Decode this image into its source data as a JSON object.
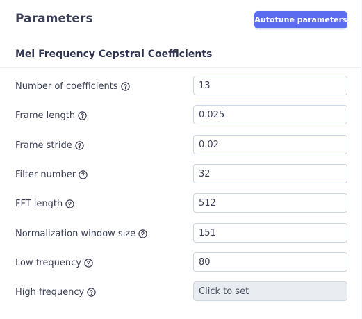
{
  "header": {
    "title": "Parameters",
    "autotune_label": "Autotune parameters"
  },
  "section": {
    "title": "Mel Frequency Cepstral Coefficients"
  },
  "params": [
    {
      "label": "Number of coefficients",
      "value": "13",
      "icon": "question-circle-icon"
    },
    {
      "label": "Frame length",
      "value": "0.025",
      "icon": "question-circle-icon"
    },
    {
      "label": "Frame stride",
      "value": "0.02",
      "icon": "question-circle-icon"
    },
    {
      "label": "Filter number",
      "value": "32",
      "icon": "question-circle-icon"
    },
    {
      "label": "FFT length",
      "value": "512",
      "icon": "question-circle-icon"
    },
    {
      "label": "Normalization window size",
      "value": "151",
      "icon": "question-circle-icon"
    },
    {
      "label": "Low frequency",
      "value": "80",
      "icon": "question-circle-icon"
    },
    {
      "label": "High frequency",
      "value": "Click to set",
      "icon": "question-circle-icon"
    }
  ],
  "colors": {
    "accent": "#5c6cf0",
    "text": "#3b3f55",
    "field_border": "#cdd6e4",
    "disabled_field_bg": "#e9edf1"
  }
}
